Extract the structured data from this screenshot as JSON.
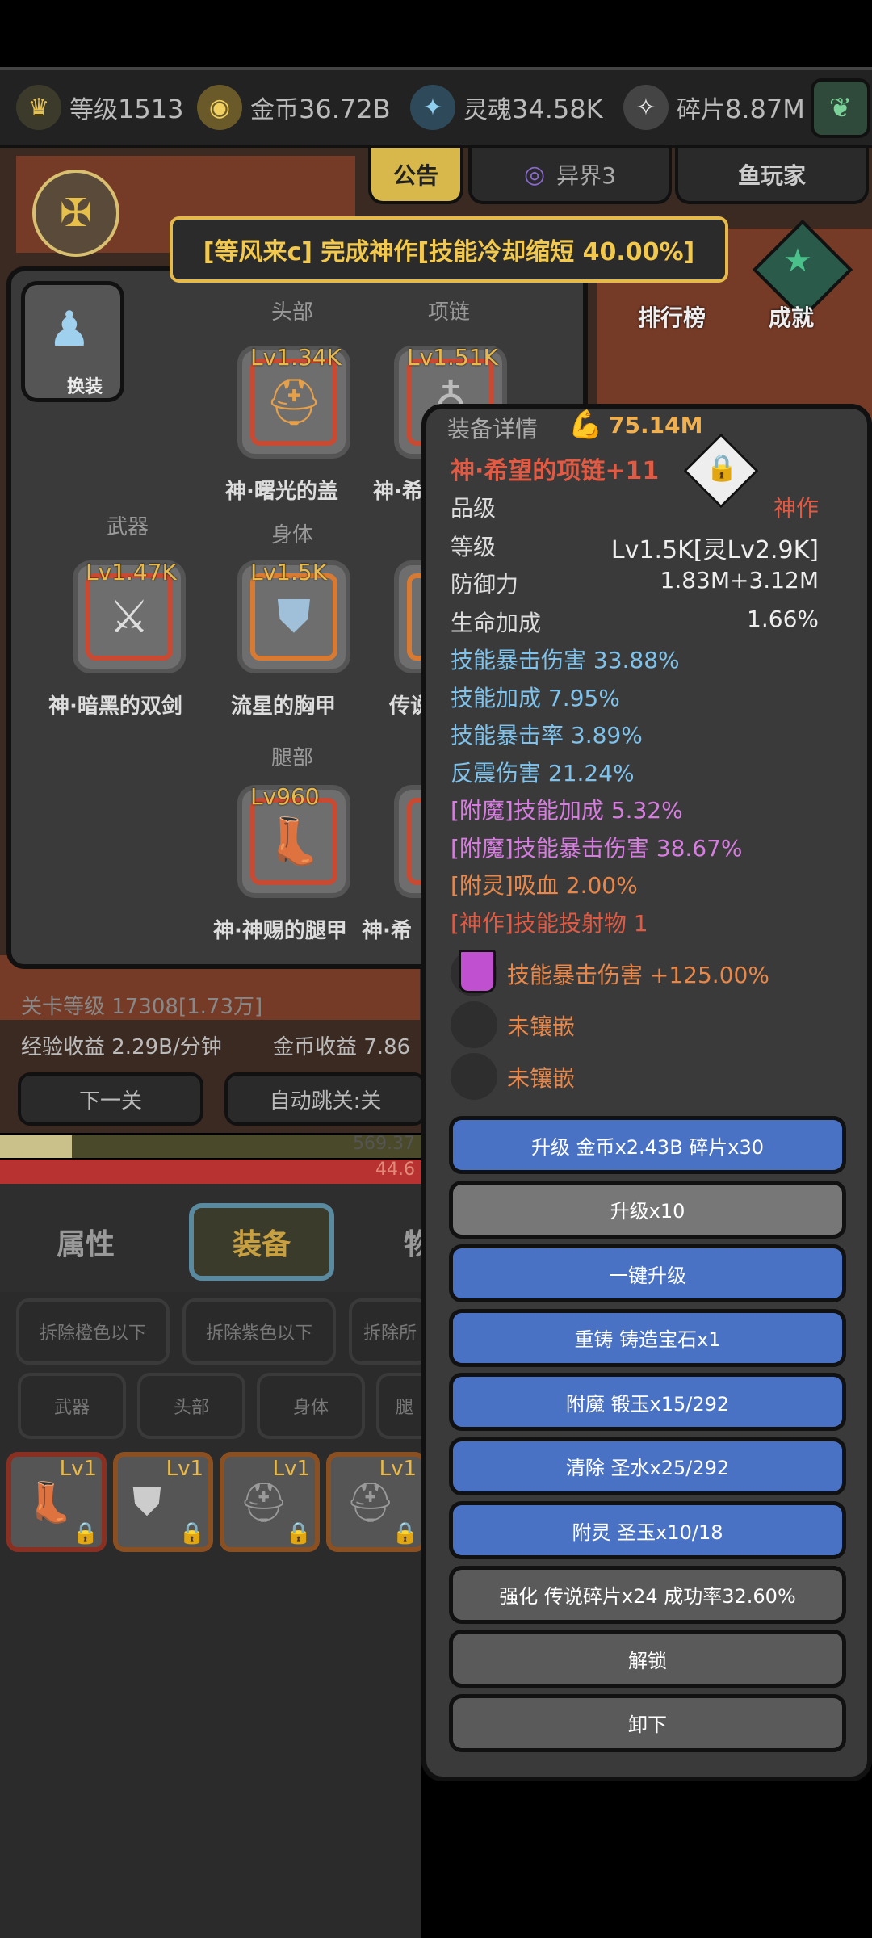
{
  "resources": [
    {
      "icon": "crown",
      "label": "等级",
      "value": "1513"
    },
    {
      "icon": "coin",
      "label": "金币",
      "value": "36.72B"
    },
    {
      "icon": "soul",
      "label": "灵魂",
      "value": "34.58K"
    },
    {
      "icon": "shard",
      "label": "碎片",
      "value": "8.87M"
    }
  ],
  "top_tabs": {
    "notice": "公告",
    "realm": "异界3",
    "player": "鱼玩家"
  },
  "banner": "[等风来c] 完成神作[技能冷却缩短 40.00%]",
  "side_labels": {
    "rank": "排行榜",
    "achieve": "成就"
  },
  "equip_panel": {
    "change_btn": "换装",
    "labels": {
      "head": "头部",
      "neck": "项链",
      "weapon": "武器",
      "body": "身体",
      "leg": "腿部"
    },
    "slots": {
      "head": {
        "lv": "Lv1.34K",
        "name": "神·曙光的盖"
      },
      "neck": {
        "lv": "Lv1.51K",
        "name": "神·希"
      },
      "weapon": {
        "lv": "Lv1.47K",
        "name": "神·暗黑的双剑"
      },
      "body": {
        "lv": "Lv1.5K",
        "name": "流星的胸甲"
      },
      "body2": {
        "name": "传说"
      },
      "leg": {
        "lv": "Lv960",
        "name": "神·神赐的腿甲"
      },
      "leg2": {
        "name": "神·希"
      }
    }
  },
  "game": {
    "stage": "关卡等级 17308[1.73万]",
    "exp": "经验收益 2.29B/分钟",
    "gold": "金币收益 7.86",
    "next_btn": "下一关",
    "auto_btn": "自动跳关:关",
    "bar1_value": "569.37",
    "bar2_value": "44.6",
    "bar1_fraction": 0.17
  },
  "tabs": {
    "attr": "属性",
    "equip": "装备",
    "item": "物"
  },
  "dismantle": [
    "拆除橙色以下",
    "拆除紫色以下",
    "拆除所"
  ],
  "filters": [
    "武器",
    "头部",
    "身体",
    "腿"
  ],
  "inventory": [
    {
      "lv": "Lv1",
      "icon": "boot"
    },
    {
      "lv": "Lv1",
      "icon": "armor"
    },
    {
      "lv": "Lv1",
      "icon": "helmet"
    },
    {
      "lv": "Lv1",
      "icon": "helmet"
    }
  ],
  "detail": {
    "header": "装备详情",
    "power": "75.14M",
    "item_name": "神·希望的项链+11",
    "quality_label": "品级",
    "quality": "神作",
    "level_label": "等级",
    "level": "Lv1.5K[灵Lv2.9K]",
    "def_label": "防御力",
    "def": "1.83M+3.12M",
    "hp_label": "生命加成",
    "hp": "1.66%",
    "stats": [
      {
        "text": "技能暴击伤害 33.88%",
        "color": "#7fc3ec"
      },
      {
        "text": "技能加成 7.95%",
        "color": "#7fc3ec"
      },
      {
        "text": "技能暴击率 3.89%",
        "color": "#7fc3ec"
      },
      {
        "text": "反震伤害 21.24%",
        "color": "#7fc3ec"
      },
      {
        "text": "[附魔]技能加成 5.32%",
        "color": "#d77ce0"
      },
      {
        "text": "[附魔]技能暴击伤害 38.67%",
        "color": "#d77ce0"
      },
      {
        "text": "[附灵]吸血 2.00%",
        "color": "#e8874a"
      },
      {
        "text": "[神作]技能投射物 1",
        "color": "#e05a44"
      }
    ],
    "gems": [
      "技能暴击伤害 +125.00%",
      "未镶嵌",
      "未镶嵌"
    ],
    "buttons": [
      {
        "label": "升级 金币x2.43B 碎片x30",
        "style": "blue"
      },
      {
        "label": "升级x10",
        "style": "grey"
      },
      {
        "label": "一键升级",
        "style": "blue"
      },
      {
        "label": "重铸 铸造宝石x1",
        "style": "blue"
      },
      {
        "label": "附魔 锻玉x15/292",
        "style": "blue"
      },
      {
        "label": "清除 圣水x25/292",
        "style": "blue"
      },
      {
        "label": "附灵 圣玉x10/18",
        "style": "blue"
      },
      {
        "label": "强化 传说碎片x24 成功率32.60%",
        "style": "dgrey"
      },
      {
        "label": "解锁",
        "style": "dgrey"
      },
      {
        "label": "卸下",
        "style": "dgrey"
      }
    ]
  }
}
